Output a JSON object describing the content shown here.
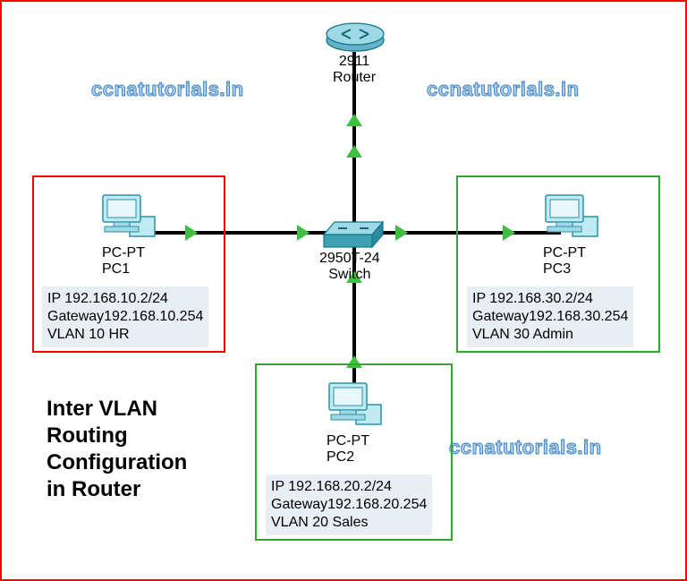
{
  "watermarks": {
    "w1": "ccnatutorials.in",
    "w2": "ccnatutorials.in",
    "w3": "ccnatutorials.in"
  },
  "title_lines": {
    "l1": "Inter VLAN",
    "l2": "Routing",
    "l3": "Configuration",
    "l4": "in Router"
  },
  "router": {
    "model": "2911",
    "label": "Router"
  },
  "switch": {
    "model": "2950T-24",
    "label": "Switch"
  },
  "pc1": {
    "type": "PC-PT",
    "name": "PC1",
    "ip": "IP 192.168.10.2/24",
    "gw": "Gateway192.168.10.254",
    "vlan": "VLAN 10 HR"
  },
  "pc2": {
    "type": "PC-PT",
    "name": "PC2",
    "ip": "IP 192.168.20.2/24",
    "gw": "Gateway192.168.20.254",
    "vlan": "VLAN 20 Sales"
  },
  "pc3": {
    "type": "PC-PT",
    "name": "PC3",
    "ip": "IP 192.168.30.2/24",
    "gw": "Gateway192.168.30.254",
    "vlan": "VLAN 30 Admin"
  }
}
